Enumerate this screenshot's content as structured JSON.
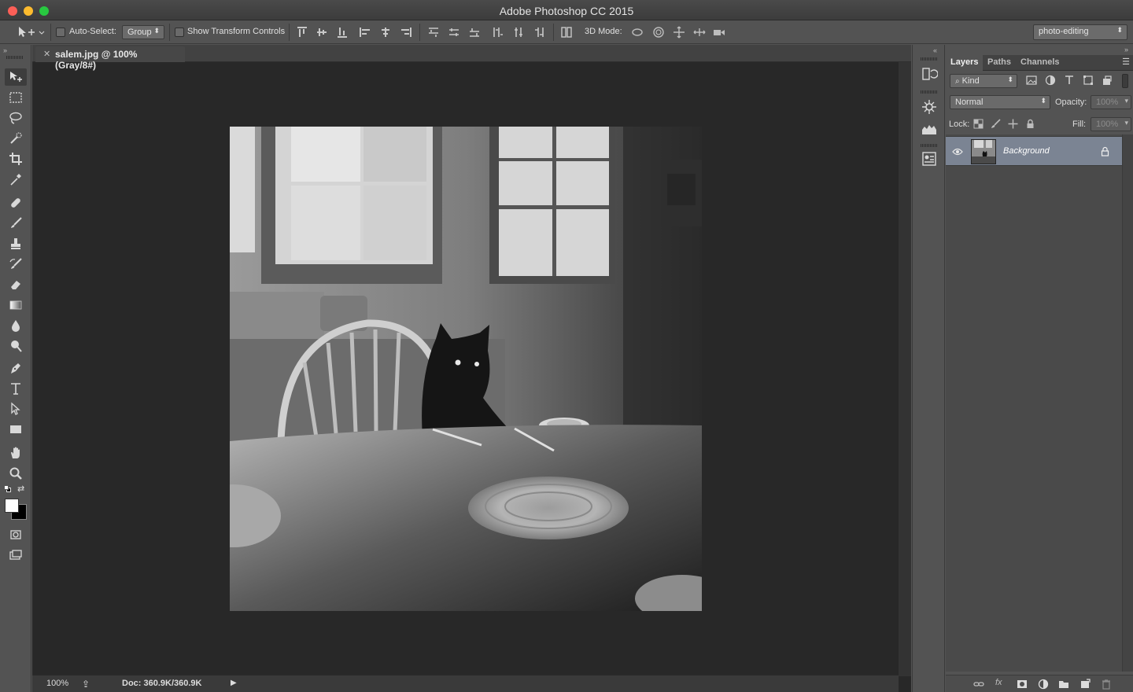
{
  "window": {
    "title": "Adobe Photoshop CC 2015"
  },
  "options_bar": {
    "auto_select_label": "Auto-Select:",
    "auto_select_checked": false,
    "auto_select_target": "Group",
    "show_transform_label": "Show Transform Controls",
    "show_transform_checked": false,
    "mode_3d_label": "3D Mode:",
    "workspace": "photo-editing"
  },
  "document": {
    "tab_title": "salem.jpg @ 100% (Gray/8#)",
    "zoom": "100%",
    "doc_info": "Doc: 360.9K/360.9K",
    "image_description_icon": "photo-canvas"
  },
  "tools": [
    "move-tool-icon",
    "marquee-tool-icon",
    "lasso-tool-icon",
    "quick-select-tool-icon",
    "crop-tool-icon",
    "eyedropper-tool-icon",
    "healing-brush-tool-icon",
    "brush-tool-icon",
    "clone-stamp-tool-icon",
    "history-brush-tool-icon",
    "eraser-tool-icon",
    "gradient-tool-icon",
    "blur-tool-icon",
    "dodge-tool-icon",
    "pen-tool-icon",
    "type-tool-icon",
    "path-select-tool-icon",
    "rectangle-tool-icon",
    "hand-tool-icon",
    "zoom-tool-icon"
  ],
  "layers_panel": {
    "tabs": [
      "Layers",
      "Paths",
      "Channels"
    ],
    "active_tab": "Layers",
    "filter_kind": "Kind",
    "blend_mode": "Normal",
    "opacity_label": "Opacity:",
    "opacity_value": "100%",
    "lock_label": "Lock:",
    "fill_label": "Fill:",
    "fill_value": "100%",
    "layers": [
      {
        "name": "Background",
        "visible": true,
        "locked": true
      }
    ]
  },
  "colors": {
    "accent_selected_layer": "#7b8493",
    "foreground_color": "#ffffff",
    "background_color": "#000000"
  }
}
